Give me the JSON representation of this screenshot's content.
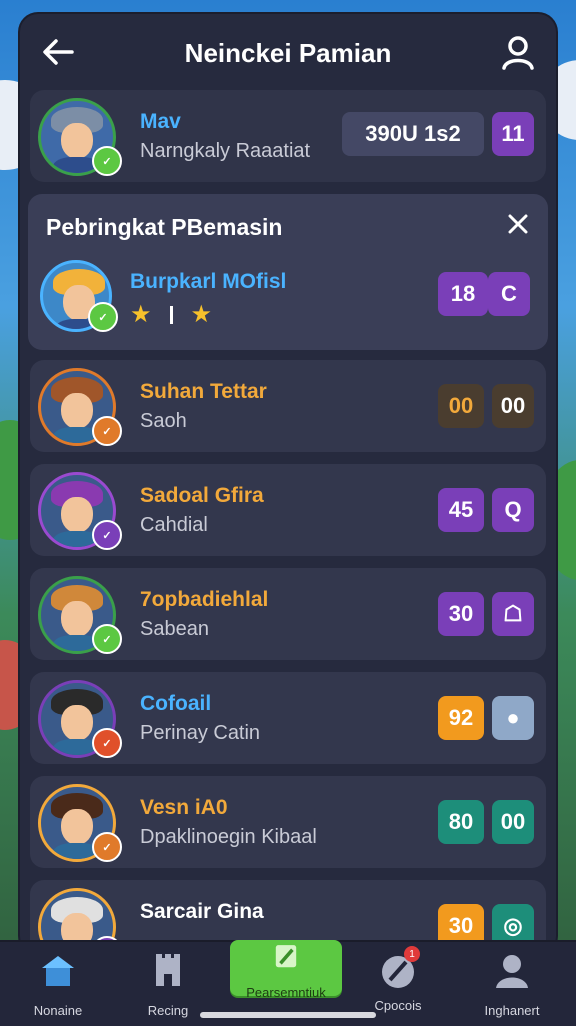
{
  "header": {
    "title": "Neinckei Pamian"
  },
  "me": {
    "name": "Mav",
    "sub": "Narngkaly Raaatiat",
    "score": "390U 1s2",
    "rank": "11",
    "level": ""
  },
  "featured": {
    "title": "Pebringkat PBemasin",
    "name": "Burpkarl MOfisl",
    "score": "18",
    "rank": "C",
    "rating": 2
  },
  "players": [
    {
      "name": "Suhan Tettar",
      "sub": "Saoh",
      "score": "00",
      "rank": "00",
      "name_color": "#f2a93b",
      "score_bg": "#4a3d2f",
      "rank_bg": "#4a3d2f",
      "score_color": "#f2a93b"
    },
    {
      "name": "Sadoal Gfira",
      "sub": "Cahdial",
      "score": "45",
      "rank": "Q",
      "name_color": "#f2a93b",
      "score_bg": "#7a3fb8",
      "rank_bg": "#7a3fb8",
      "score_color": "#ffffff"
    },
    {
      "name": "7opbadiehlal",
      "sub": "Sabean",
      "score": "30",
      "rank": "☖",
      "name_color": "#f2a93b",
      "score_bg": "#7a3fb8",
      "rank_bg": "#7a3fb8",
      "score_color": "#ffffff"
    },
    {
      "name": "Cofoail",
      "sub": "Perinay Catin",
      "score": "92",
      "rank": "●",
      "name_color": "#4ab3ff",
      "score_bg": "#f29a1e",
      "rank_bg": "#8fa8c8",
      "score_color": "#ffffff"
    },
    {
      "name": "Vesn iA0",
      "sub": "Dpaklinoegin Kibaal",
      "score": "80",
      "rank": "00",
      "name_color": "#f2a93b",
      "score_bg": "#1d8e7a",
      "rank_bg": "#1d8e7a",
      "score_color": "#ffffff"
    },
    {
      "name": "Sarcair Gina",
      "sub": "",
      "score": "30",
      "rank": "◎",
      "name_color": "#ffffff",
      "score_bg": "#f29a1e",
      "rank_bg": "#1d8e7a",
      "score_color": "#ffffff"
    }
  ],
  "tabs": [
    {
      "label": "Nonaine",
      "icon": "home-icon"
    },
    {
      "label": "Recing",
      "icon": "castle-icon"
    },
    {
      "label": "Pearsemntiuk",
      "icon": "edit-icon"
    },
    {
      "label": "Cpocois",
      "icon": "rocket-icon",
      "badge": "1"
    },
    {
      "label": "Inghanert",
      "icon": "user-icon"
    }
  ],
  "colors": {
    "accent_purple": "#7a3fb8",
    "accent_green": "#5cc842",
    "panel": "#262a3e"
  }
}
